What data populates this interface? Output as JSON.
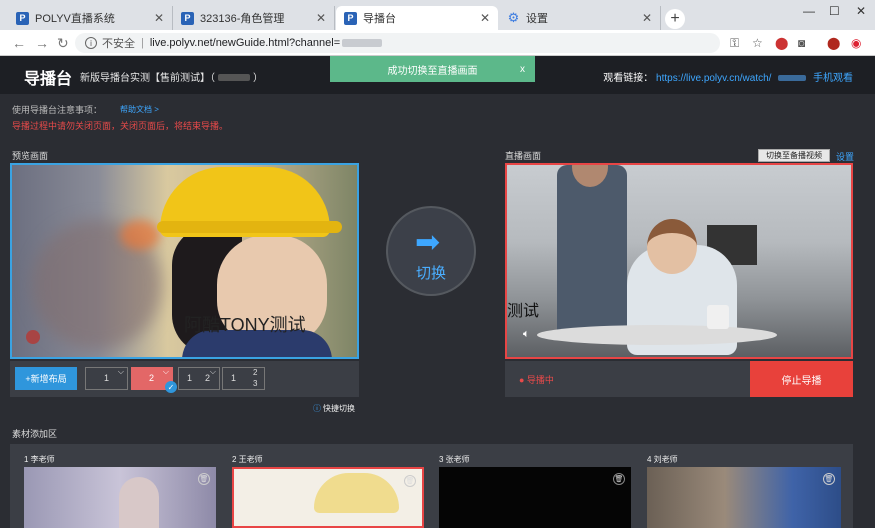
{
  "browser": {
    "tabs": [
      {
        "title": "POLYV直播系统",
        "icon": "polyv-favicon"
      },
      {
        "title": "323136-角色管理",
        "icon": "polyv-favicon"
      },
      {
        "title": "导播台",
        "icon": "polyv-favicon"
      },
      {
        "title": "设置",
        "icon": "gear-icon"
      }
    ],
    "active_tab_index": 2,
    "new_tab_label": "+",
    "security_label": "不安全",
    "url": "live.polyv.net/newGuide.html?channel="
  },
  "header": {
    "logo": "导播台",
    "channel_title": "新版导播台实测【售前测试】（",
    "channel_title_end": "）",
    "toast": "成功切换至直播画面",
    "toast_close": "x",
    "watch_label": "观看链接：",
    "watch_url": "https://live.polyv.cn/watch/",
    "mobile_watch": "手机观看"
  },
  "notes": {
    "title": "使用导播台注意事项：",
    "help_link": "帮助文档 >",
    "warning": "导播过程中请勿关闭页面，关闭页面后，将结束导播。"
  },
  "preview": {
    "label": "预览画面",
    "overlay_text": "阿酷TONY测试",
    "add_layout": "+新增布局",
    "layouts": [
      {
        "label": "1"
      },
      {
        "label": "2"
      },
      {
        "label": "1",
        "label2": "2"
      },
      {
        "label": "1",
        "label2": "2",
        "label3": "3"
      }
    ],
    "selected_layout_index": 1,
    "quick_switch": "快捷切换"
  },
  "switch": {
    "label": "切换"
  },
  "live": {
    "label": "直播画面",
    "overlay_text": "测试",
    "backup_button": "切换至备播视频",
    "settings": "设置",
    "status": "● 导播中",
    "stop_button": "停止导播"
  },
  "materials": {
    "label": "素材添加区",
    "items": [
      {
        "label": "1 李老师"
      },
      {
        "label": "2 王老师"
      },
      {
        "label": "3 张老师"
      },
      {
        "label": "4 刘老师"
      }
    ]
  },
  "colors": {
    "accent": "#3ea7ff",
    "danger": "#e8413b",
    "toast": "#5cb88a",
    "background": "#2b2d33"
  }
}
